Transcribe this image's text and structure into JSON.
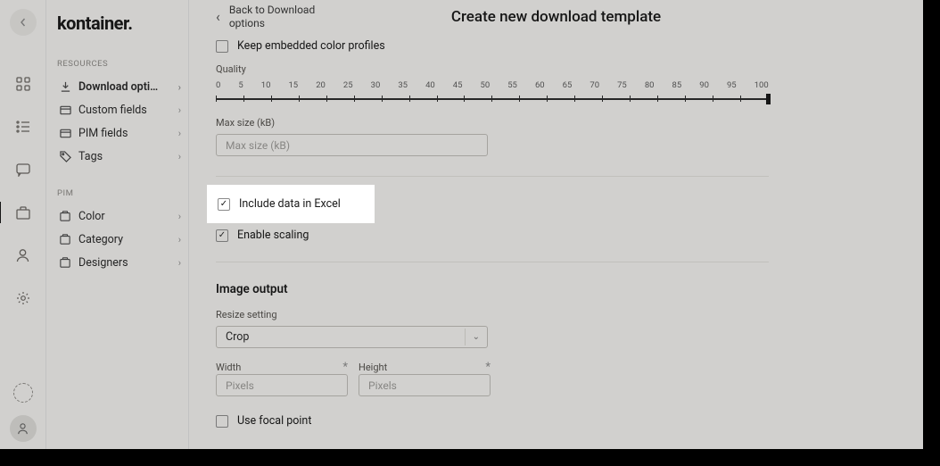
{
  "logo": "kontainer.",
  "rail": {
    "icons": [
      "grid",
      "list",
      "chat",
      "briefcase",
      "user",
      "gear"
    ]
  },
  "sidebar": {
    "sections": [
      {
        "label": "RESOURCES",
        "items": [
          {
            "icon": "download",
            "label": "Download optio…",
            "active": true
          },
          {
            "icon": "field",
            "label": "Custom fields"
          },
          {
            "icon": "field",
            "label": "PIM fields"
          },
          {
            "icon": "tag",
            "label": "Tags"
          }
        ]
      },
      {
        "label": "PIM",
        "items": [
          {
            "icon": "box",
            "label": "Color"
          },
          {
            "icon": "box",
            "label": "Category"
          },
          {
            "icon": "box",
            "label": "Designers"
          }
        ]
      }
    ]
  },
  "header": {
    "back": "Back to Download options",
    "title": "Create new download template"
  },
  "form": {
    "keep_profiles": "Keep embedded color profiles",
    "quality_label": "Quality",
    "quality_ticks": [
      "0",
      "5",
      "10",
      "15",
      "20",
      "25",
      "30",
      "35",
      "40",
      "45",
      "50",
      "55",
      "60",
      "65",
      "70",
      "75",
      "80",
      "85",
      "90",
      "95",
      "100"
    ],
    "maxsize_label": "Max size (kB)",
    "maxsize_placeholder": "Max size (kB)",
    "include_excel": "Include data in Excel",
    "enable_scaling": "Enable scaling",
    "image_output": "Image output",
    "resize_label": "Resize setting",
    "resize_value": "Crop",
    "width_label": "Width",
    "height_label": "Height",
    "pixels_placeholder": "Pixels",
    "focal_point": "Use focal point"
  }
}
